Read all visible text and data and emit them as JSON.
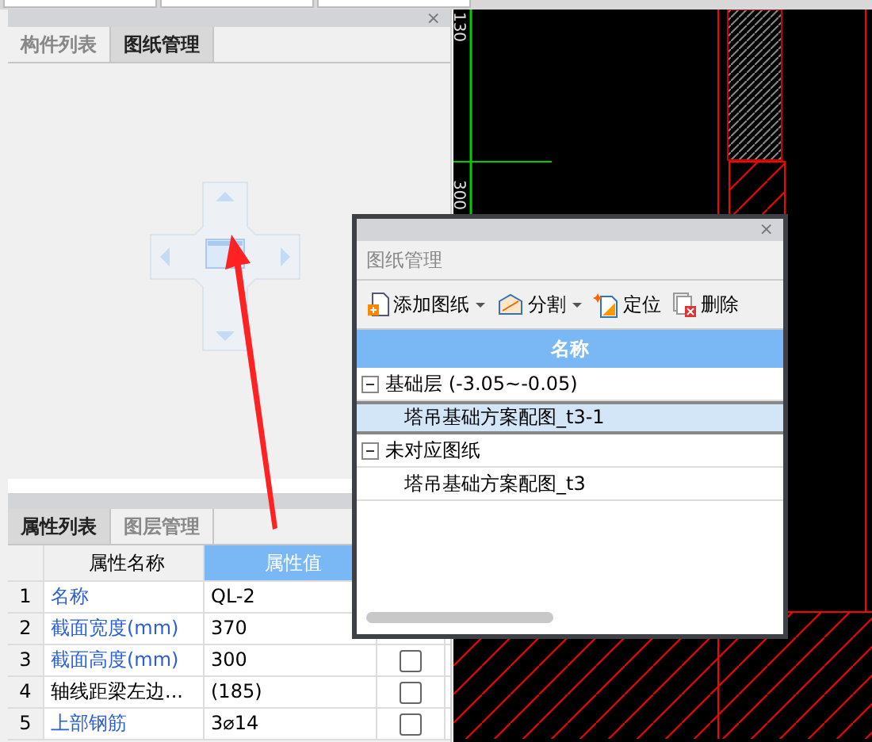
{
  "left_panel": {
    "close": "×",
    "tabs": [
      {
        "label": "构件列表",
        "selected": false
      },
      {
        "label": "图纸管理",
        "selected": true
      }
    ]
  },
  "properties_panel": {
    "tabs": [
      {
        "label": "属性列表",
        "selected": true
      },
      {
        "label": "图层管理",
        "selected": false
      }
    ],
    "columns": [
      "属性名称",
      "属性值"
    ],
    "rows": [
      {
        "index": "1",
        "name": "名称",
        "value": "QL-2",
        "linked": true
      },
      {
        "index": "2",
        "name": "截面宽度(mm)",
        "value": "370",
        "linked": true
      },
      {
        "index": "3",
        "name": "截面高度(mm)",
        "value": "300",
        "linked": true,
        "checked": false
      },
      {
        "index": "4",
        "name": "轴线距梁左边...",
        "value": "(185)",
        "linked": false,
        "checked": false
      },
      {
        "index": "5",
        "name": "上部钢筋",
        "value": "3⌀14",
        "linked": true,
        "checked": false
      }
    ]
  },
  "cad_view": {
    "dimension_labels": [
      "130",
      "300"
    ]
  },
  "drawing_dialog": {
    "close": "×",
    "title": "图纸管理",
    "toolbar": [
      {
        "label": "添加图纸",
        "kind": "add",
        "dropdown": true
      },
      {
        "label": "分割",
        "kind": "split",
        "dropdown": true
      },
      {
        "label": "定位",
        "kind": "locate",
        "dropdown": false
      },
      {
        "label": "删除",
        "kind": "delete",
        "dropdown": false
      }
    ],
    "column": "名称",
    "tree": [
      {
        "label": "基础层 (-3.05~-0.05)",
        "expanded": true,
        "selected": false,
        "children": [
          {
            "label": "塔吊基础方案配图_t3-1",
            "selected": true
          }
        ]
      },
      {
        "label": "未对应图纸",
        "expanded": true,
        "selected": false,
        "children": [
          {
            "label": "塔吊基础方案配图_t3",
            "selected": false
          }
        ]
      }
    ]
  }
}
